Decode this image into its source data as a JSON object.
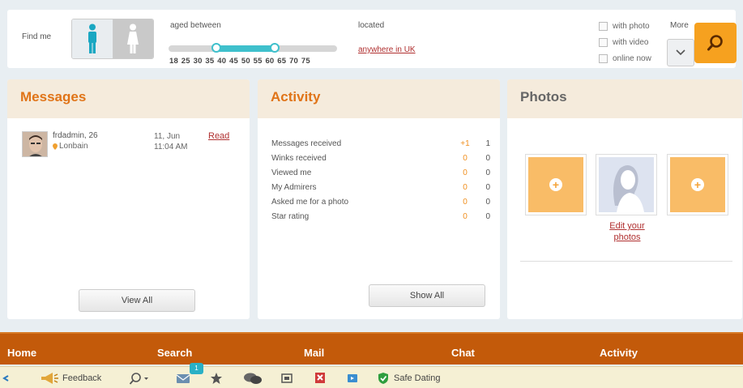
{
  "search": {
    "find_me_label": "Find me",
    "aged_label": "aged between",
    "age_ticks": "18 25 30 35 40 45 50 55 60 65 70 75",
    "age_range": {
      "min": 35,
      "max": 55
    },
    "located_label": "located",
    "location": "anywhere in UK",
    "filters": [
      {
        "label": "with photo",
        "checked": false
      },
      {
        "label": "with video",
        "checked": false
      },
      {
        "label": "online now",
        "checked": false
      }
    ],
    "more_label": "More"
  },
  "messages": {
    "title": "Messages",
    "items": [
      {
        "name": "frdadmin, 26",
        "location": "Lonbain",
        "date": "11, Jun",
        "time": "11:04 AM",
        "action": "Read"
      }
    ],
    "view_all": "View All"
  },
  "activity": {
    "title": "Activity",
    "rows": [
      {
        "label": "Messages received",
        "new": "+1",
        "total": "1"
      },
      {
        "label": "Winks received",
        "new": "0",
        "total": "0"
      },
      {
        "label": "Viewed me",
        "new": "0",
        "total": "0"
      },
      {
        "label": "My Admirers",
        "new": "0",
        "total": "0"
      },
      {
        "label": "Asked me for a photo",
        "new": "0",
        "total": "0"
      },
      {
        "label": "Star rating",
        "new": "0",
        "total": "0"
      }
    ],
    "show_all": "Show All"
  },
  "photos": {
    "title": "Photos",
    "edit_label": "Edit your photos"
  },
  "nav": {
    "items": [
      "Home",
      "Search",
      "Mail",
      "Chat",
      "Activity"
    ]
  },
  "taskbar": {
    "feedback": "Feedback",
    "mail_badge": "1",
    "safe_dating": "Safe Dating"
  },
  "colors": {
    "accent": "#f6a11f",
    "nav_bg": "#c35a0a",
    "slider": "#3fc0cc",
    "link": "#b03030"
  }
}
